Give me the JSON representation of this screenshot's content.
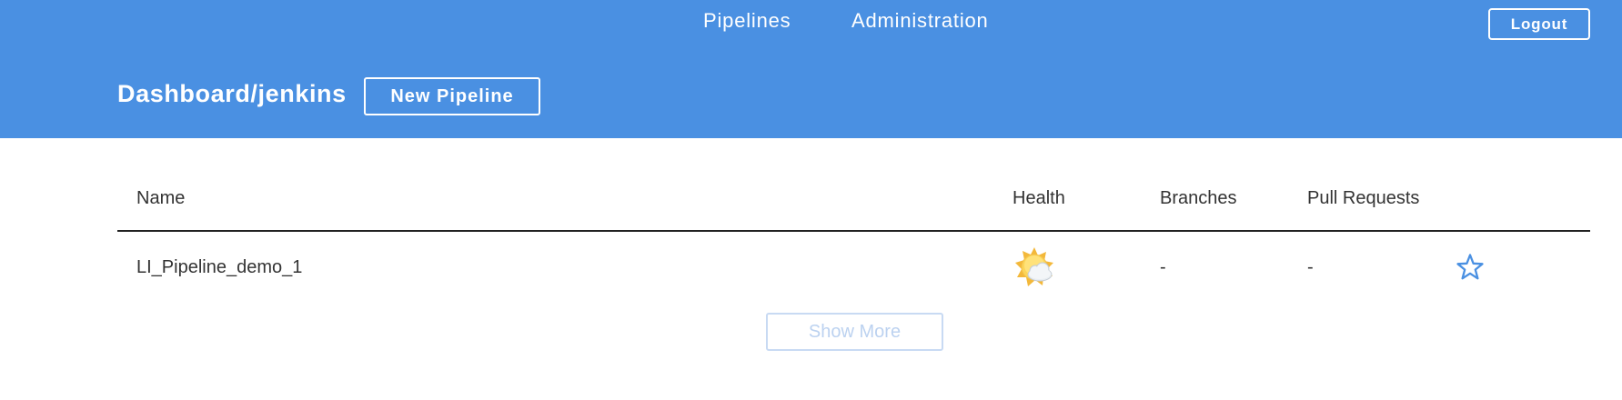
{
  "header": {
    "nav": [
      {
        "label": "Pipelines"
      },
      {
        "label": "Administration"
      }
    ],
    "logout_label": "Logout",
    "title": "Dashboard/jenkins",
    "new_pipeline_label": "New Pipeline",
    "background_color": "#4a90e2"
  },
  "table": {
    "columns": [
      "Name",
      "Health",
      "Branches",
      "Pull Requests"
    ],
    "rows": [
      {
        "name": "LI_Pipeline_demo_1",
        "health_icon": "weather-partly-cloudy-icon",
        "branches": "-",
        "pull_requests": "-",
        "favorite_icon": "star-outline-icon"
      }
    ]
  },
  "show_more_label": "Show More",
  "colors": {
    "accent": "#4a90e2",
    "text": "#333333",
    "disabled": "#bcd2f0"
  }
}
